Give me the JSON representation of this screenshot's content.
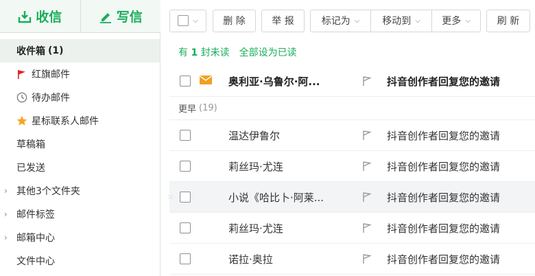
{
  "compose": {
    "receive_label": "收信",
    "write_label": "写信"
  },
  "sidebar": {
    "items": [
      {
        "label": "收件箱",
        "count": "(1)"
      },
      {
        "label": "红旗邮件"
      },
      {
        "label": "待办邮件"
      },
      {
        "label": "星标联系人邮件"
      },
      {
        "label": "草稿箱"
      },
      {
        "label": "已发送"
      },
      {
        "label": "其他3个文件夹"
      },
      {
        "label": "邮件标签"
      },
      {
        "label": "邮箱中心"
      },
      {
        "label": "文件中心"
      }
    ]
  },
  "toolbar": {
    "delete_label": "删 除",
    "report_label": "举 报",
    "mark_as_label": "标记为",
    "move_to_label": "移动到",
    "more_label": "更多",
    "refresh_label": "刷 新"
  },
  "unread": {
    "prefix": "有",
    "count": "1",
    "suffix": "封未读",
    "mark_all_label": "全部设为已读"
  },
  "group": {
    "label": "更早",
    "count": "(19)"
  },
  "emails": [
    {
      "sender": "奥利亚·乌鲁尔·阿...",
      "subject": "抖音创作者回复您的邀请"
    },
    {
      "sender": "温达伊鲁尔",
      "subject": "抖音创作者回复您的邀请"
    },
    {
      "sender": "莉丝玛·尤连",
      "subject": "抖音创作者回复您的邀请"
    },
    {
      "sender": "小说《哈比卜·阿莱...",
      "subject": "抖音创作者回复您的邀请"
    },
    {
      "sender": "莉丝玛·尤连",
      "subject": "抖音创作者回复您的邀请"
    },
    {
      "sender": "诺拉·奥拉",
      "subject": "抖音创作者回复您的邀请"
    }
  ],
  "colors": {
    "accent": "#1aad5b",
    "flag_red": "#e02020",
    "star": "#f5a623",
    "envelope": "#f0a020"
  }
}
